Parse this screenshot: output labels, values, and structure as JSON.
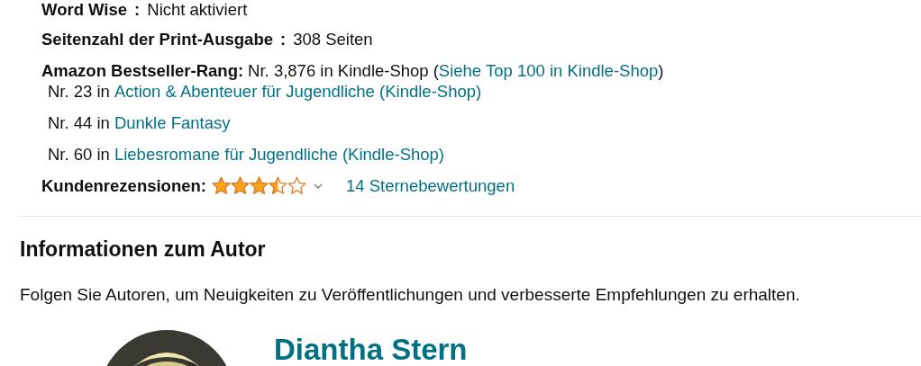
{
  "details": [
    {
      "label": "Word Wise",
      "separator": ":",
      "value": "Nicht aktiviert"
    },
    {
      "label": "Seitenzahl der Print-Ausgabe",
      "separator": ":",
      "value": "308 Seiten"
    }
  ],
  "bestseller": {
    "label": "Amazon Bestseller-Rang:",
    "rank": "Nr. 3,876 in Kindle-Shop",
    "open_paren": "(",
    "link": "Siehe Top 100 in Kindle-Shop",
    "close_paren": ")",
    "categories": [
      {
        "rank": "Nr. 23 in",
        "link": "Action & Abenteuer für Jugendliche (Kindle-Shop)"
      },
      {
        "rank": "Nr. 44 in",
        "link": "Dunkle Fantasy"
      },
      {
        "rank": "Nr. 60 in",
        "link": "Liebesromane für Jugendliche (Kindle-Shop)"
      }
    ]
  },
  "reviews": {
    "label": "Kundenrezensionen:",
    "stars": 3.5,
    "ratings_link": "14 Sternebewertungen"
  },
  "author_section": {
    "heading": "Informationen zum Autor",
    "text": "Folgen Sie Autoren, um Neuigkeiten zu Veröffentlichungen und verbesserte Empfehlungen zu erhalten.",
    "author_name": "Diantha Stern"
  }
}
